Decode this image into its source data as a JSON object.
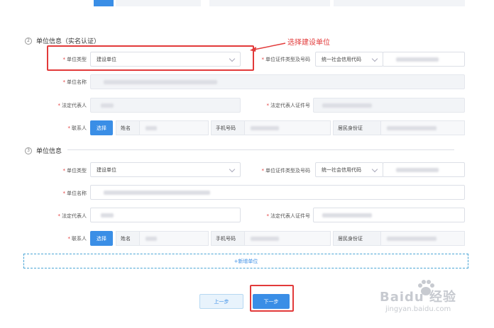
{
  "section2": {
    "number": "2",
    "title": "单位信息（实名认证）",
    "annotation": "选择建设单位",
    "unit_type_label": "单位类型",
    "unit_type_value": "建设单位",
    "cert_type_label": "单位证件类型及号码",
    "cert_type_value": "统一社会信用代码",
    "unit_name_label": "单位名称",
    "legal_rep_label": "法定代表人",
    "legal_rep_id_label": "法定代表人证件号",
    "contact_label": "联系人",
    "select_btn": "选择",
    "name_label": "姓名",
    "phone_label": "手机号码",
    "id_label": "居民身份证"
  },
  "section3": {
    "number": "3",
    "title": "单位信息",
    "unit_type_label": "单位类型",
    "unit_type_value": "建设单位",
    "cert_type_label": "单位证件类型及号码",
    "cert_type_value": "统一社会信用代码",
    "unit_name_label": "单位名称",
    "legal_rep_label": "法定代表人",
    "legal_rep_id_label": "法定代表人证件号",
    "contact_label": "联系人",
    "select_btn": "选择",
    "name_label": "姓名",
    "phone_label": "手机号码",
    "id_label": "居民身份证"
  },
  "add_unit": "+新增单位",
  "prev_btn": "上一步",
  "next_btn": "下一步",
  "watermark": {
    "brand": "Baidu 经验",
    "url": "jingyan.baidu.com"
  },
  "colors": {
    "accent": "#3a8ee6",
    "highlight": "#e23a3a"
  }
}
